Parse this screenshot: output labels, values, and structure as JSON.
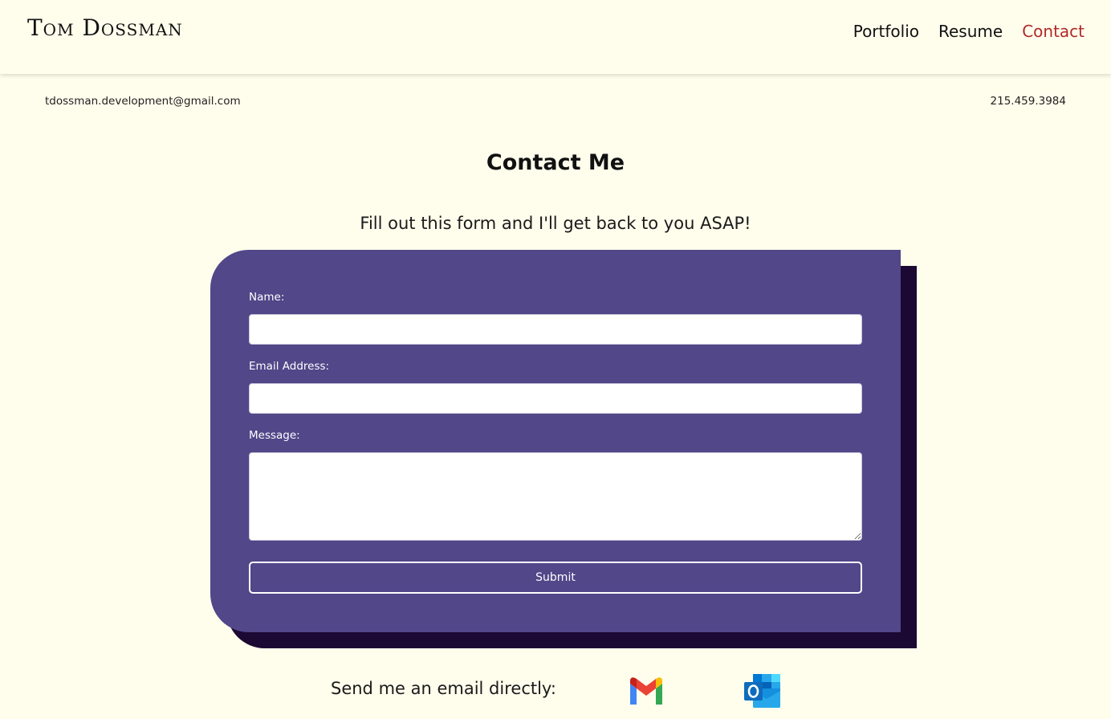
{
  "header": {
    "logo": "Tom Dossman",
    "nav": [
      {
        "label": "Portfolio",
        "active": false
      },
      {
        "label": "Resume",
        "active": false
      },
      {
        "label": "Contact",
        "active": true
      }
    ]
  },
  "contact_info": {
    "email": "tdossman.development@gmail.com",
    "phone": "215.459.3984"
  },
  "main": {
    "title": "Contact Me",
    "subtitle": "Fill out this form and I'll get back to you ASAP!"
  },
  "form": {
    "name_label": "Name:",
    "name_value": "",
    "email_label": "Email Address:",
    "email_value": "",
    "message_label": "Message:",
    "message_value": "",
    "submit_label": "Submit"
  },
  "direct": {
    "text": "Send me an email directly:",
    "icons": [
      "gmail-icon",
      "outlook-icon"
    ]
  },
  "colors": {
    "background": "#fffdec",
    "card": "#514789",
    "card_shadow": "#1b0833",
    "accent": "#b02a2a"
  }
}
